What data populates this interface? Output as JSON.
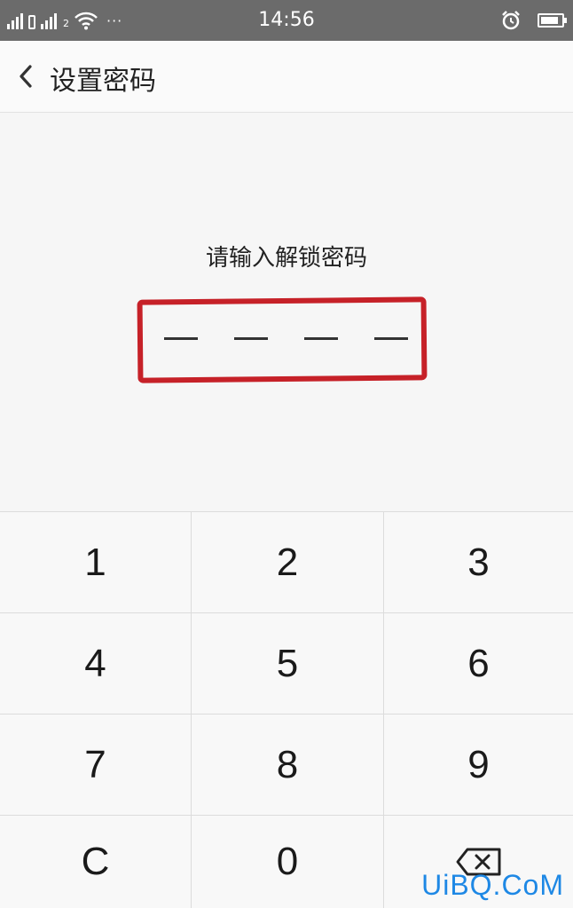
{
  "status_bar": {
    "time": "14:56",
    "sim2_label": "2",
    "more_dots": "···",
    "battery_level": 0.85,
    "icons": [
      "signal-icon",
      "signal-icon",
      "wifi-icon",
      "alarm-icon",
      "battery-icon"
    ]
  },
  "header": {
    "title": "设置密码",
    "back_icon": "chevron-left-icon"
  },
  "pin": {
    "prompt": "请输入解锁密码",
    "slots": 4,
    "entered": 0,
    "highlight_color": "#c62128"
  },
  "keypad": {
    "keys": [
      "1",
      "2",
      "3",
      "4",
      "5",
      "6",
      "7",
      "8",
      "9",
      "C",
      "0"
    ],
    "delete_icon": "backspace-icon"
  },
  "watermark": "UiBQ.CoM"
}
